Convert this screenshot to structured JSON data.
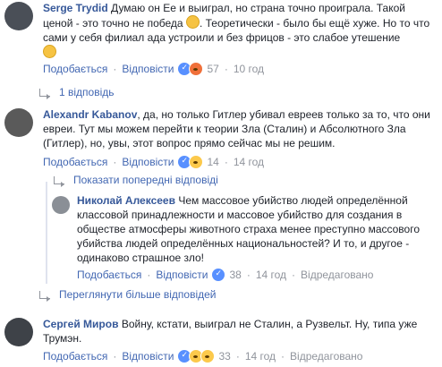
{
  "comments": [
    {
      "author": "Serge Trydid",
      "text": "Думаю он Ее и выиграл, но страна точно проиграла. Такой ценой - это точно не победа",
      "text2": ". Теоретически - было бы ещё хуже. Но то что сами у себя филиал ада устроили и без фрицов - это слабое утешение",
      "like_label": "Подобається",
      "reply_label": "Відповісти",
      "reaction_count": "57",
      "time": "10 год",
      "replies_link": "1 відповідь"
    },
    {
      "author": "Alexandr Kabanov",
      "text": "да, но только Гитлер убивал евреев только за то, что они евреи. Тут мы можем перейти к теории Зла (Сталин) и Абсолютного Зла (Гитлер), но, увы, этот вопрос прямо сейчас мы не решим.",
      "like_label": "Подобається",
      "reply_label": "Відповісти",
      "reaction_count": "14",
      "time": "14 год",
      "prev_replies_link": "Показати попередні відповіді",
      "reply": {
        "author": "Николай Алексеев",
        "text": "Чем массовое убийство людей определённой классовой принадлежности и массовое убийство для создания в обществе атмосферы животного страха менее преступно массового убийства людей определённых национальностей? И то, и другое - одинаково страшное зло!",
        "like_label": "Подобається",
        "reply_label": "Відповісти",
        "reaction_count": "38",
        "time": "14 год",
        "edited": "Відредаговано"
      },
      "more_replies_link": "Переглянути більше відповідей"
    },
    {
      "author": "Сергей Миров",
      "text": "Войну, кстати, выиграл не Сталин, а Рузвельт. Ну, типа уже Трумэн.",
      "like_label": "Подобається",
      "reply_label": "Відповісти",
      "reaction_count": "33",
      "time": "14 год",
      "edited": "Відредаговано"
    }
  ],
  "separator": "·"
}
